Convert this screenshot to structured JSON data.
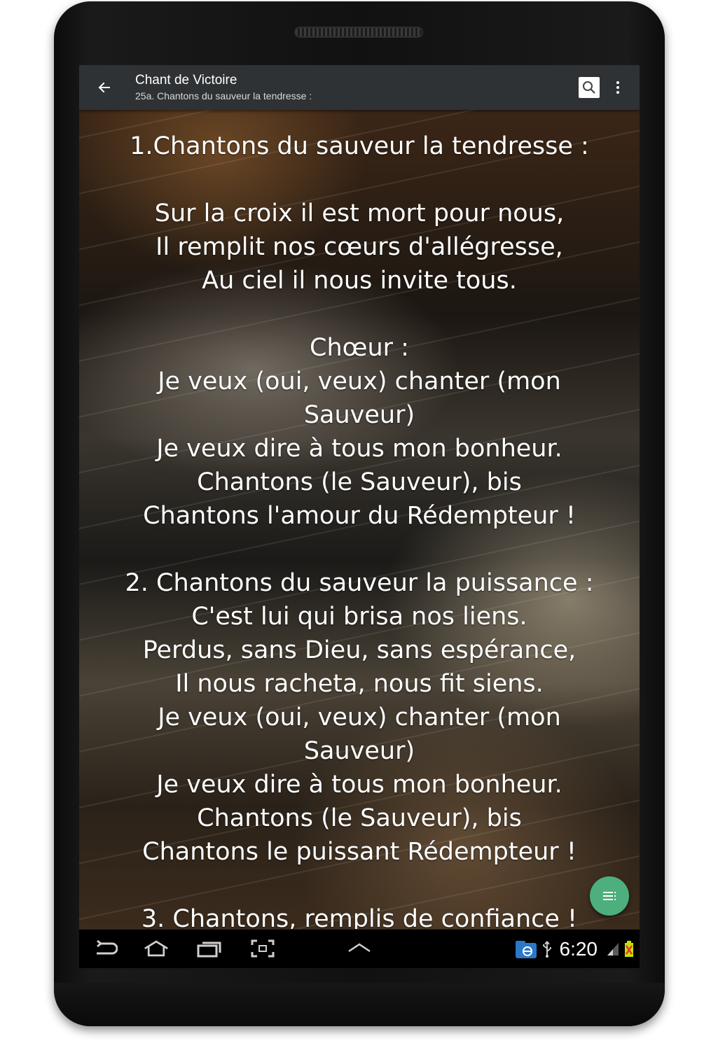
{
  "header": {
    "title": "Chant de Victoire",
    "subtitle": "25a. Chantons du sauveur la tendresse :"
  },
  "lyrics": {
    "text": "1.Chantons du sauveur la tendresse :\n\nSur la croix il est mort pour nous,\nIl remplit nos cœurs d'allégresse,\nAu ciel il nous invite tous.\n\nChœur :\nJe veux (oui, veux) chanter (mon\nSauveur)\nJe veux dire à tous mon bonheur.\nChantons (le Sauveur), bis\nChantons l'amour du Rédempteur !\n\n2. Chantons du sauveur la puissance :\nC'est lui qui brisa nos liens.\nPerdus, sans Dieu, sans espérance,\nIl nous racheta, nous fit siens.\nJe veux (oui, veux) chanter (mon\nSauveur)\nJe veux dire à tous mon bonheur.\nChantons (le Sauveur), bis\nChantons le puissant Rédempteur !\n\n3. Chantons, remplis de confiance !"
  },
  "status_bar": {
    "time": "6:20"
  },
  "icons": {
    "back": "back-arrow-icon",
    "search": "search-icon",
    "overflow": "more-vert-icon",
    "fab": "list-icon",
    "nav_back": "nav-back-icon",
    "nav_home": "nav-home-icon",
    "nav_recents": "nav-recents-icon",
    "nav_screenshot": "screenshot-icon",
    "nav_up": "chevron-up-icon"
  },
  "colors": {
    "appbar": "#2f3234",
    "fab": "#4caf7d",
    "battery_low": "#e53935",
    "battery_charge": "#c6e000"
  }
}
